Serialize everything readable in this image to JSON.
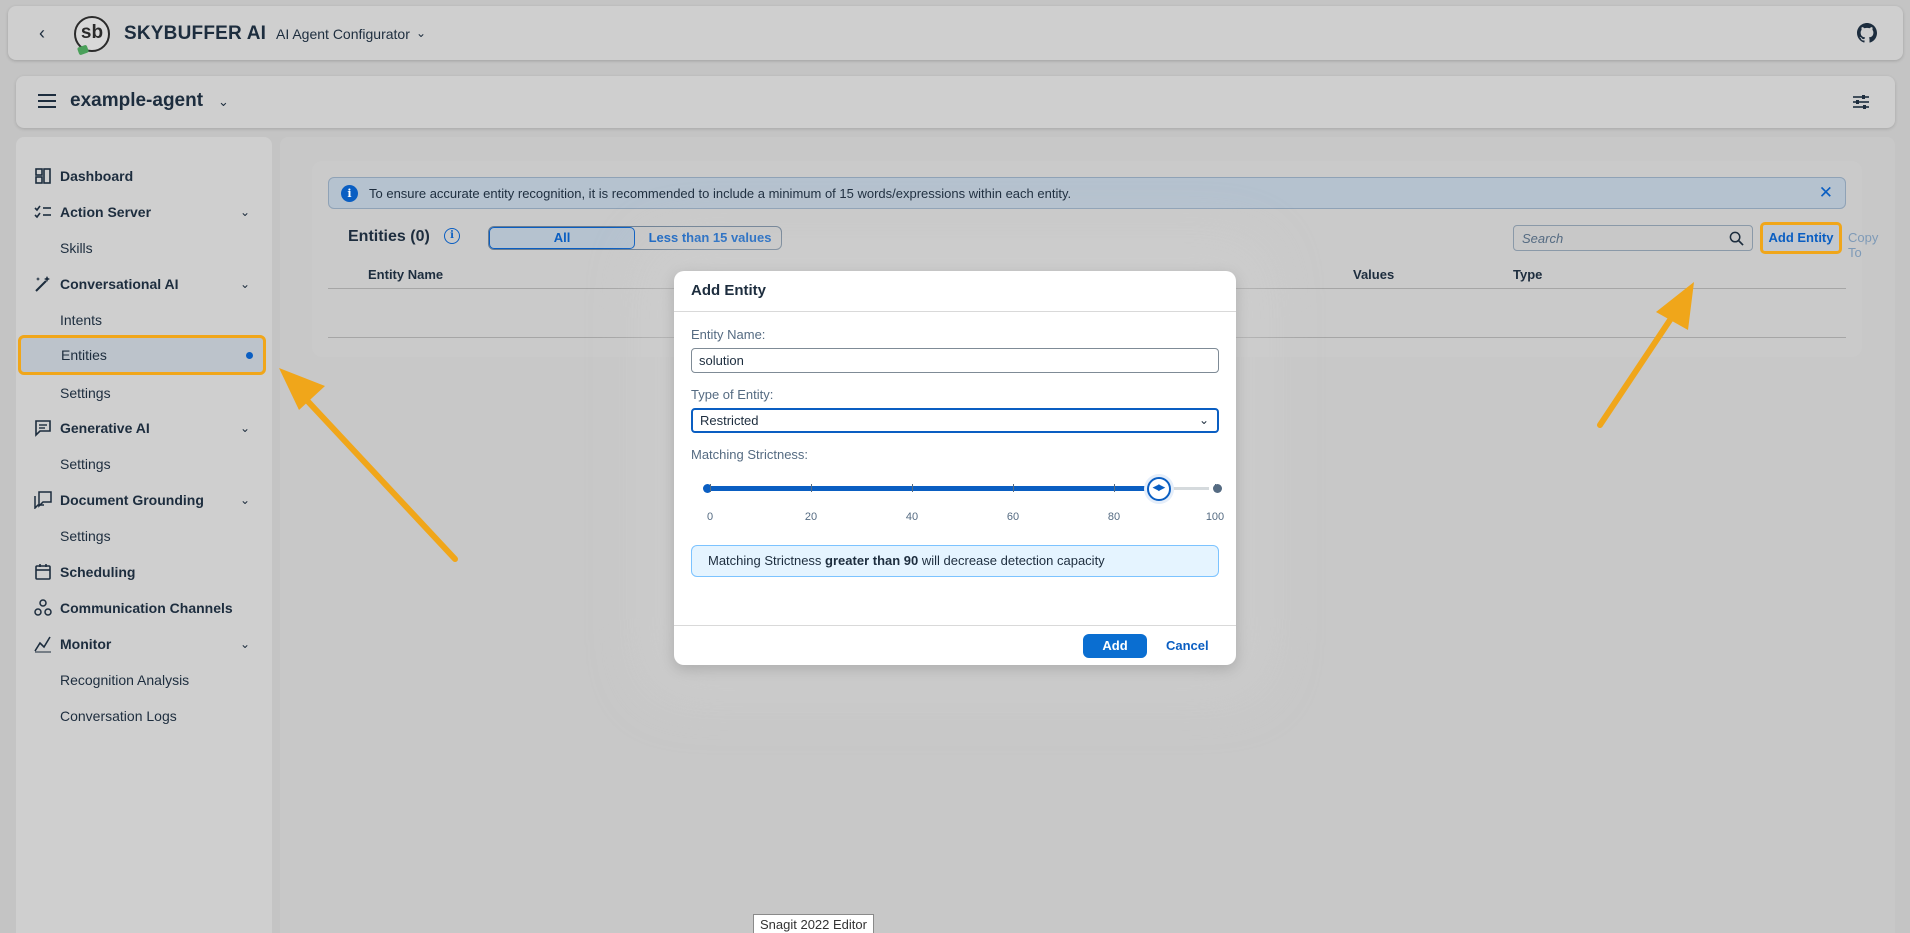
{
  "shellbar": {
    "brand": "SKYBUFFER AI",
    "product": "AI Agent Configurator",
    "logo_text": "sb"
  },
  "subheader": {
    "agent_name": "example-agent"
  },
  "sidebar": {
    "items": [
      {
        "label": "Dashboard",
        "icon": "dashboard-icon"
      },
      {
        "label": "Action Server",
        "icon": "checklist-icon"
      },
      {
        "label": "Skills"
      },
      {
        "label": "Conversational AI",
        "icon": "magic-wand-icon"
      },
      {
        "label": "Intents"
      },
      {
        "label": "Entities"
      },
      {
        "label": "Settings"
      },
      {
        "label": "Generative AI",
        "icon": "chat-icon"
      },
      {
        "label": "Settings"
      },
      {
        "label": "Document Grounding",
        "icon": "document-chat-icon"
      },
      {
        "label": "Settings"
      },
      {
        "label": "Scheduling",
        "icon": "calendar-icon"
      },
      {
        "label": "Communication Channels",
        "icon": "channels-icon"
      },
      {
        "label": "Monitor",
        "icon": "chart-line-icon"
      },
      {
        "label": "Recognition Analysis"
      },
      {
        "label": "Conversation Logs"
      }
    ]
  },
  "main": {
    "info_text": "To ensure accurate entity recognition, it is recommended to include a minimum of 15 words/expressions within each entity.",
    "title": "Entities (0)",
    "filter_all": "All",
    "filter_less": "Less than 15 values",
    "search_placeholder": "Search",
    "add_entity": "Add Entity",
    "copy_to": "Copy To",
    "columns": [
      "Entity Name",
      "Values",
      "Type"
    ]
  },
  "dialog": {
    "title": "Add Entity",
    "entity_name_label": "Entity Name:",
    "entity_name_value": "solution",
    "type_label": "Type of Entity:",
    "type_value": "Restricted",
    "strictness_label": "Matching Strictness:",
    "strictness_value": 89,
    "slider_min": 0,
    "slider_max": 100,
    "tick_labels": [
      "0",
      "20",
      "40",
      "60",
      "80",
      "100"
    ],
    "warning_prefix": "Matching Strictness ",
    "warning_bold": "greater than 90",
    "warning_suffix": " will decrease detection capacity",
    "add_button": "Add",
    "cancel_button": "Cancel"
  },
  "tooltip": "Snagit 2022 Editor",
  "colors": {
    "accent": "#0a5ec2",
    "highlight": "#f0a61a"
  }
}
